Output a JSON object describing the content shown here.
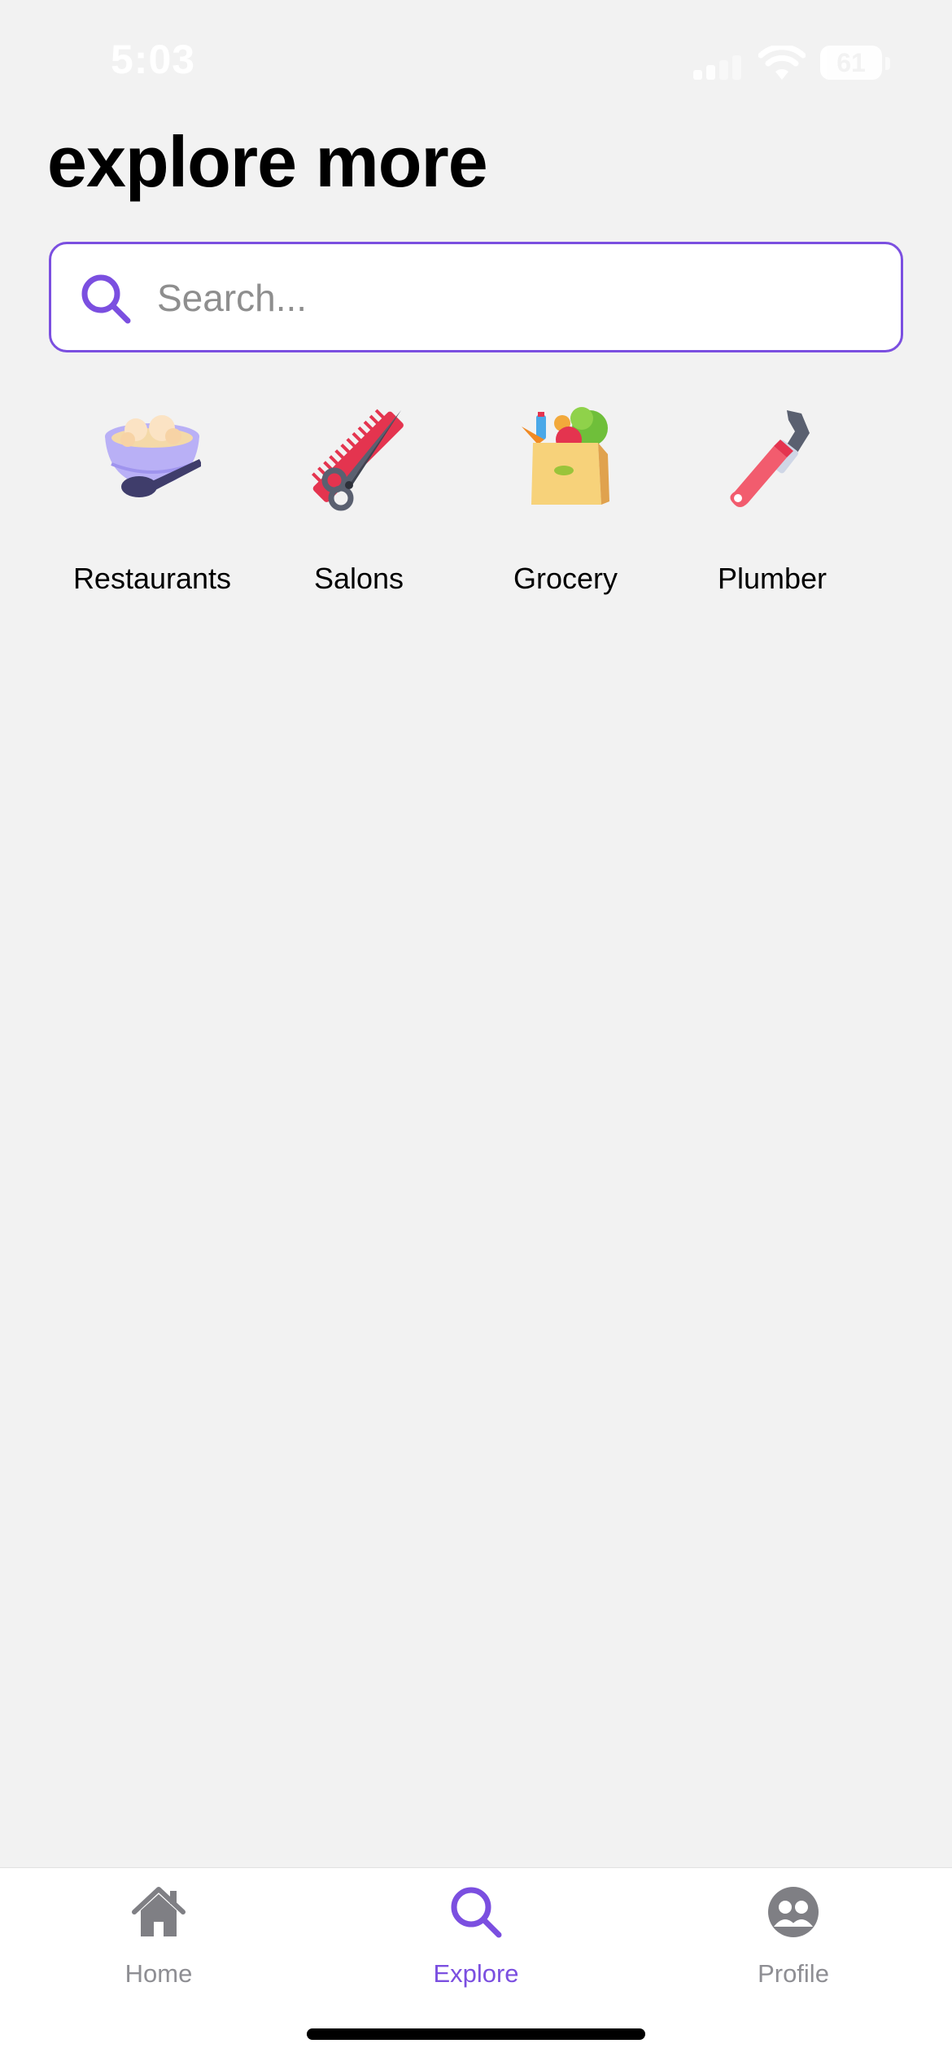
{
  "status_bar": {
    "time": "5:03",
    "battery": "61",
    "icons": [
      "signal-icon",
      "wifi-icon",
      "battery-icon"
    ]
  },
  "page": {
    "title": "explore more"
  },
  "search": {
    "placeholder": "Search...",
    "value": "",
    "icon": "search-icon",
    "accent_color": "#7b4fe0"
  },
  "categories": [
    {
      "label": "Restaurants",
      "icon": "bowl-with-spoon-icon"
    },
    {
      "label": "Salons",
      "icon": "scissors-and-comb-icon"
    },
    {
      "label": "Grocery",
      "icon": "grocery-bag-icon"
    },
    {
      "label": "Plumber",
      "icon": "pipe-wrench-icon"
    }
  ],
  "tab_bar": {
    "active_index": 1,
    "active_color": "#7b4fe0",
    "inactive_color": "#8e8e93",
    "tabs": [
      {
        "label": "Home",
        "icon": "house-icon"
      },
      {
        "label": "Explore",
        "icon": "search-icon"
      },
      {
        "label": "Profile",
        "icon": "people-icon"
      }
    ]
  }
}
